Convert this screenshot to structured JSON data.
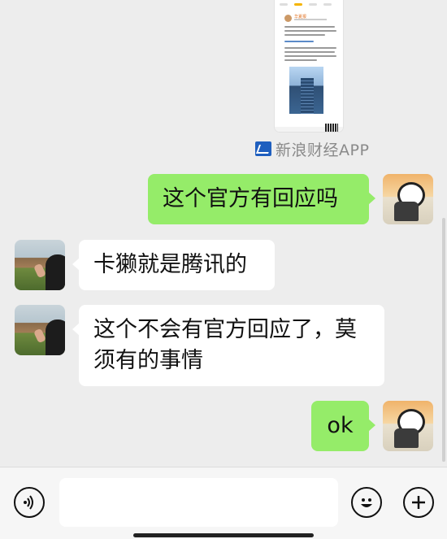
{
  "shared_card": {
    "author_name": "华夏报",
    "brand_label": "新浪财经APP"
  },
  "messages": [
    {
      "side": "right",
      "text": "这个官方有回应吗"
    },
    {
      "side": "left",
      "text": "卡獭就是腾讯的"
    },
    {
      "side": "left",
      "text_line1": "这个不会有官方回应了，莫",
      "text_line2": "须有的事情"
    },
    {
      "side": "right",
      "text": "ok"
    }
  ],
  "input_bar": {
    "input_value": ""
  },
  "icons": {
    "voice": "voice-icon",
    "emoji": "emoji-icon",
    "plus": "plus-icon"
  },
  "colors": {
    "background": "#ededed",
    "bubble_sent": "#95ec69",
    "bubble_received": "#ffffff",
    "brand_blue": "#1f5fbf"
  }
}
